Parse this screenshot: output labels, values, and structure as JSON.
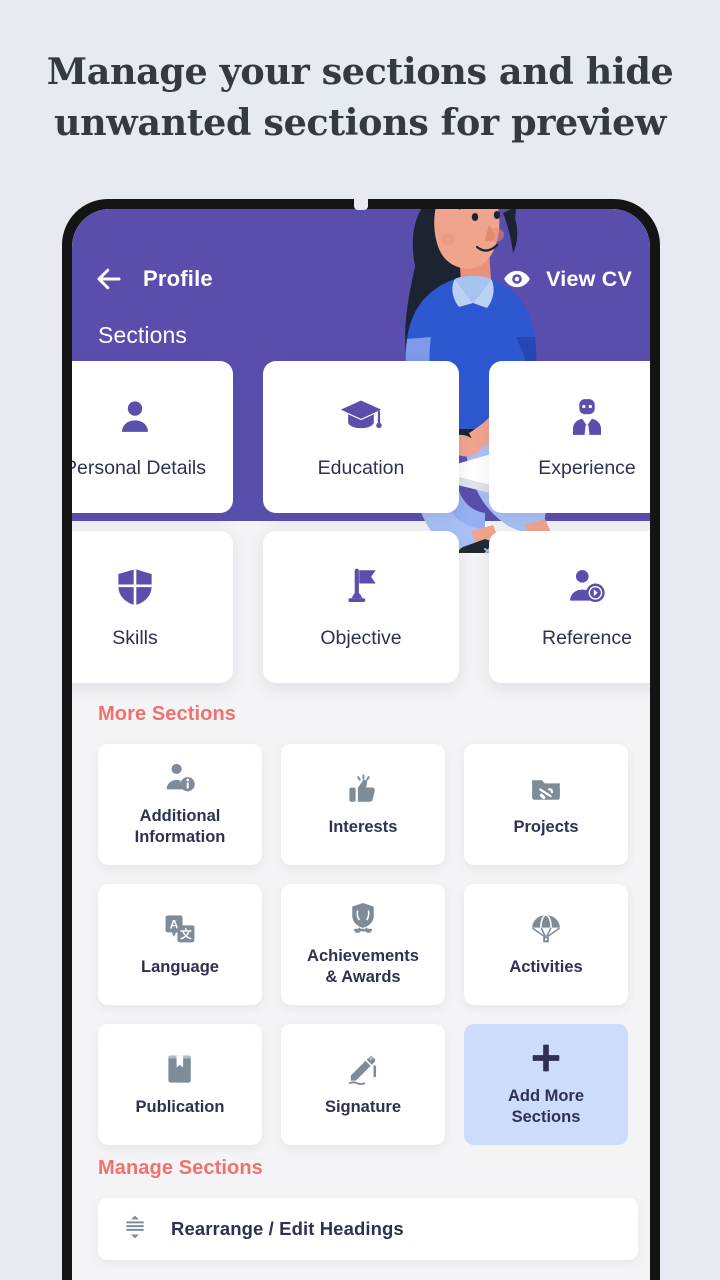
{
  "headline": {
    "line1": "Manage your sections and hide",
    "line2": "unwanted sections for preview"
  },
  "colors": {
    "page_background": "#e7eaf1",
    "phone_bezel": "#141414",
    "screen_background": "#f4f4f6",
    "appbar_purple": "#5a4ead",
    "accent_icon_purple": "#5b4fae",
    "muted_icon_slate": "#7e8c9a",
    "text_navy": "#2e3151",
    "heading_coral": "#f2716e",
    "highlight_card_blue": "#cedcfb"
  },
  "appbar": {
    "back_icon": "back-arrow-icon",
    "title": "Profile",
    "view_cv_icon": "eye-icon",
    "view_cv_label": "View CV",
    "sections_title": "Sections"
  },
  "main_sections": [
    {
      "label": "Personal Details",
      "icon": "person-icon"
    },
    {
      "label": "Education",
      "icon": "graduation-cap-icon"
    },
    {
      "label": "Experience",
      "icon": "business-person-icon"
    },
    {
      "label": "Skills",
      "icon": "shield-icon"
    },
    {
      "label": "Objective",
      "icon": "flag-icon"
    },
    {
      "label": "Reference",
      "icon": "person-arrow-icon"
    }
  ],
  "more_sections": {
    "heading": "More Sections",
    "items": [
      {
        "label": "Additional\nInformation",
        "label_line1": "Additional",
        "label_line2": "Information",
        "icon": "person-info-icon"
      },
      {
        "label": "Interests",
        "icon": "thumbs-up-icon"
      },
      {
        "label": "Projects",
        "icon": "folder-tools-icon"
      },
      {
        "label": "Language",
        "icon": "translate-icon"
      },
      {
        "label": "Achievements & Awards",
        "label_line1": "Achievements",
        "label_line2": "& Awards",
        "icon": "award-shield-icon"
      },
      {
        "label": "Activities",
        "icon": "parachute-icon"
      },
      {
        "label": "Publication",
        "icon": "book-bookmark-icon"
      },
      {
        "label": "Signature",
        "icon": "signature-hand-icon"
      },
      {
        "label": "Add More Sections",
        "label_line1": "Add More",
        "label_line2": "Sections",
        "icon": "plus-icon",
        "highlighted": true
      }
    ]
  },
  "manage_sections": {
    "heading": "Manage Sections",
    "row_icon": "rearrange-icon",
    "row_label": "Rearrange / Edit Headings"
  }
}
